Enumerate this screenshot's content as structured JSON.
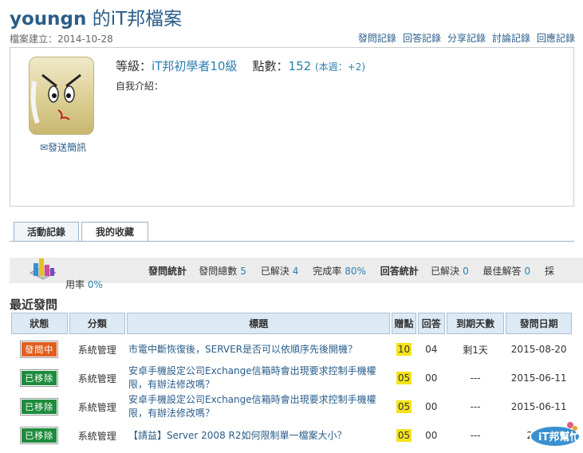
{
  "header": {
    "user": "youngn",
    "title_suffix": " 的iT邦檔案",
    "created": "檔案建立：2014-10-28",
    "links": [
      "發問記錄",
      "回答記錄",
      "分享記錄",
      "討論記錄",
      "回應記錄"
    ]
  },
  "profile": {
    "send_message": "發送簡訊",
    "level_label": "等級：",
    "level_value": "iT邦初學者10級",
    "points_label": "點數：",
    "points_value": "152",
    "week_label": "(本週：",
    "week_value": "+2",
    "week_close": ")",
    "intro_label": "自我介紹："
  },
  "tabs": [
    "活動記錄",
    "我的收藏"
  ],
  "stats": {
    "ask_stats": "發問統計",
    "ask_total_label": "發問總數",
    "ask_total": "5",
    "solved_label": "已解決",
    "solved": "4",
    "completion_label": "完成率",
    "completion": "80%",
    "answer_stats": "回答統計",
    "ans_solved_label": "已解決",
    "ans_solved": "0",
    "best_label": "最佳解答",
    "best": "0",
    "adopt_prefix": "採",
    "adopt_suffix": "用率",
    "adopt_rate": "0%"
  },
  "recent": {
    "title": "最近發問",
    "columns": [
      "狀態",
      "分類",
      "標題",
      "贈點",
      "回答",
      "到期天數",
      "發問日期"
    ],
    "rows": [
      {
        "status": "發問中",
        "status_type": "open",
        "category": "系統管理",
        "title": "市電中斷恢復後，SERVER是否可以依順序先後開機？",
        "points": "10",
        "answers": "04",
        "days": "剩1天",
        "date": "2015-08-20"
      },
      {
        "status": "已移除",
        "status_type": "moved",
        "category": "系統管理",
        "title": "安卓手機設定公司Exchange信箱時會出現要求控制手機權限，有辦法修改嗎？",
        "points": "05",
        "answers": "00",
        "days": "---",
        "date": "2015-06-11"
      },
      {
        "status": "已移除",
        "status_type": "moved",
        "category": "系統管理",
        "title": "安卓手機設定公司Exchange信箱時會出現要求控制手機權限，有辦法修改嗎？",
        "points": "05",
        "answers": "00",
        "days": "---",
        "date": "2015-06-11"
      },
      {
        "status": "已移除",
        "status_type": "moved",
        "category": "系統管理",
        "title": "【請益】Server 2008 R2如何限制單一檔案大小？",
        "points": "05",
        "answers": "00",
        "days": "---",
        "date": "2015"
      }
    ]
  },
  "colors": {
    "accent": "#2a5d8a",
    "open": "#e06020",
    "moved": "#1e8c3c",
    "points_bg": "#f5e31a"
  },
  "logo_text": "iT邦幫忙"
}
